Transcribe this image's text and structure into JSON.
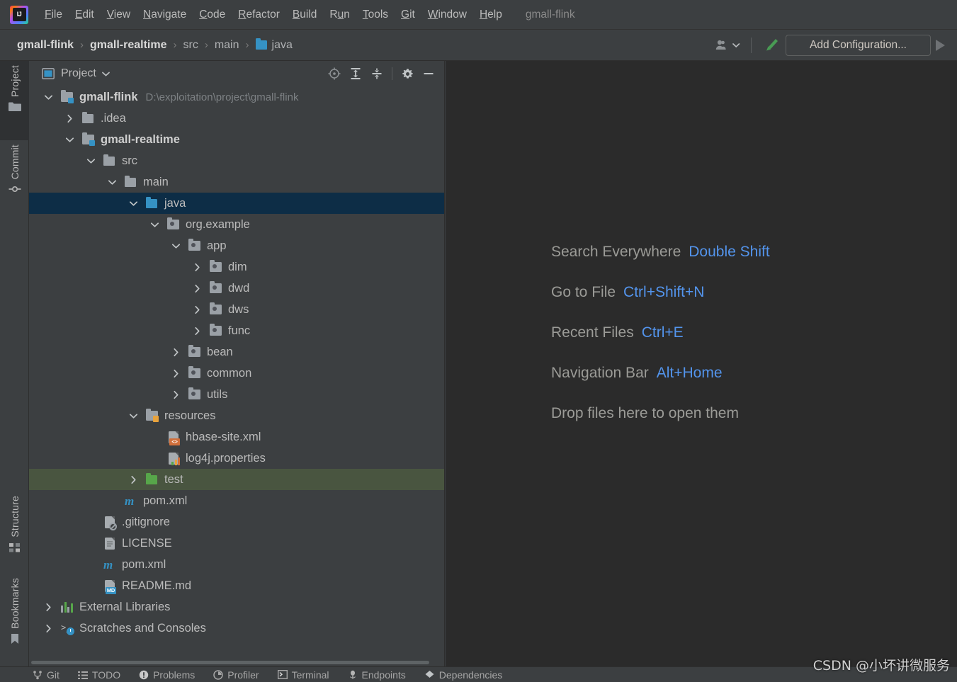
{
  "app": {
    "window_title": "gmall-flink",
    "logo_text": "IJ"
  },
  "menubar": {
    "items": [
      {
        "label": "File",
        "mnemonic": "F"
      },
      {
        "label": "Edit",
        "mnemonic": "E"
      },
      {
        "label": "View",
        "mnemonic": "V"
      },
      {
        "label": "Navigate",
        "mnemonic": "N"
      },
      {
        "label": "Code",
        "mnemonic": "C"
      },
      {
        "label": "Refactor",
        "mnemonic": "R"
      },
      {
        "label": "Build",
        "mnemonic": "B"
      },
      {
        "label": "Run",
        "mnemonic": "u"
      },
      {
        "label": "Tools",
        "mnemonic": "T"
      },
      {
        "label": "Git",
        "mnemonic": "G"
      },
      {
        "label": "Window",
        "mnemonic": "W"
      },
      {
        "label": "Help",
        "mnemonic": "H"
      }
    ]
  },
  "navbar": {
    "breadcrumbs": [
      {
        "label": "gmall-flink",
        "bold": true,
        "icon": null
      },
      {
        "label": "gmall-realtime",
        "bold": true,
        "icon": null
      },
      {
        "label": "src",
        "bold": false,
        "icon": null
      },
      {
        "label": "main",
        "bold": false,
        "icon": null
      },
      {
        "label": "java",
        "bold": false,
        "icon": "folder-blue-icon"
      }
    ],
    "separator": "›",
    "add_configuration_label": "Add Configuration...",
    "icons": [
      "user-account-icon",
      "chevron-down-icon",
      "build-hammer-icon",
      "run-play-icon"
    ]
  },
  "stripe": {
    "items": [
      {
        "label": "Project",
        "icon": "folder-icon",
        "active": true
      },
      {
        "label": "Commit",
        "icon": "commit-icon",
        "active": false
      },
      {
        "label": "Structure",
        "icon": "structure-icon",
        "active": false
      },
      {
        "label": "Bookmarks",
        "icon": "bookmark-icon",
        "active": false
      }
    ]
  },
  "project_panel": {
    "title": "Project",
    "title_icon": "project-view-icon",
    "dropdown_icon": "chevron-down-icon",
    "header_buttons": [
      {
        "name": "select-opened-file-icon"
      },
      {
        "name": "expand-all-icon"
      },
      {
        "name": "collapse-all-icon"
      },
      {
        "name": "settings-gear-icon"
      },
      {
        "name": "hide-minimize-icon"
      }
    ],
    "tree": [
      {
        "label": "gmall-flink",
        "path": "D:\\exploitation\\project\\gmall-flink",
        "indent": 0,
        "twisty": "down",
        "icon": "module-icon",
        "bold": true,
        "state": "none"
      },
      {
        "label": ".idea",
        "path": "",
        "indent": 1,
        "twisty": "right",
        "icon": "folder-grey-icon",
        "bold": false,
        "state": "none"
      },
      {
        "label": "gmall-realtime",
        "path": "",
        "indent": 1,
        "twisty": "down",
        "icon": "module-icon",
        "bold": true,
        "state": "none"
      },
      {
        "label": "src",
        "path": "",
        "indent": 2,
        "twisty": "down",
        "icon": "folder-grey-icon",
        "bold": false,
        "state": "none"
      },
      {
        "label": "main",
        "path": "",
        "indent": 3,
        "twisty": "down",
        "icon": "folder-grey-icon",
        "bold": false,
        "state": "none"
      },
      {
        "label": "java",
        "path": "",
        "indent": 4,
        "twisty": "down",
        "icon": "folder-blue-icon",
        "bold": false,
        "state": "selected-blue"
      },
      {
        "label": "org.example",
        "path": "",
        "indent": 5,
        "twisty": "down",
        "icon": "package-icon",
        "bold": false,
        "state": "none"
      },
      {
        "label": "app",
        "path": "",
        "indent": 6,
        "twisty": "down",
        "icon": "package-icon",
        "bold": false,
        "state": "none"
      },
      {
        "label": "dim",
        "path": "",
        "indent": 7,
        "twisty": "right",
        "icon": "package-icon",
        "bold": false,
        "state": "none"
      },
      {
        "label": "dwd",
        "path": "",
        "indent": 7,
        "twisty": "right",
        "icon": "package-icon",
        "bold": false,
        "state": "none"
      },
      {
        "label": "dws",
        "path": "",
        "indent": 7,
        "twisty": "right",
        "icon": "package-icon",
        "bold": false,
        "state": "none"
      },
      {
        "label": "func",
        "path": "",
        "indent": 7,
        "twisty": "right",
        "icon": "package-icon",
        "bold": false,
        "state": "none"
      },
      {
        "label": "bean",
        "path": "",
        "indent": 6,
        "twisty": "right",
        "icon": "package-icon",
        "bold": false,
        "state": "none"
      },
      {
        "label": "common",
        "path": "",
        "indent": 6,
        "twisty": "right",
        "icon": "package-icon",
        "bold": false,
        "state": "none"
      },
      {
        "label": "utils",
        "path": "",
        "indent": 6,
        "twisty": "right",
        "icon": "package-icon",
        "bold": false,
        "state": "none"
      },
      {
        "label": "resources",
        "path": "",
        "indent": 4,
        "twisty": "down",
        "icon": "resources-folder-icon",
        "bold": false,
        "state": "none"
      },
      {
        "label": "hbase-site.xml",
        "path": "",
        "indent": 5,
        "twisty": "none",
        "icon": "xml-file-icon",
        "bold": false,
        "state": "none"
      },
      {
        "label": "log4j.properties",
        "path": "",
        "indent": 5,
        "twisty": "none",
        "icon": "properties-file-icon",
        "bold": false,
        "state": "none"
      },
      {
        "label": "test",
        "path": "",
        "indent": 4,
        "twisty": "right",
        "icon": "folder-green-icon",
        "bold": false,
        "state": "selected-green"
      },
      {
        "label": "pom.xml",
        "path": "",
        "indent": 3,
        "twisty": "none",
        "icon": "maven-file-icon",
        "bold": false,
        "state": "none"
      },
      {
        "label": ".gitignore",
        "path": "",
        "indent": 2,
        "twisty": "none",
        "icon": "gitignore-file-icon",
        "bold": false,
        "state": "none"
      },
      {
        "label": "LICENSE",
        "path": "",
        "indent": 2,
        "twisty": "none",
        "icon": "text-file-icon",
        "bold": false,
        "state": "none"
      },
      {
        "label": "pom.xml",
        "path": "",
        "indent": 2,
        "twisty": "none",
        "icon": "maven-file-icon",
        "bold": false,
        "state": "none"
      },
      {
        "label": "README.md",
        "path": "",
        "indent": 2,
        "twisty": "none",
        "icon": "markdown-file-icon",
        "bold": false,
        "state": "none"
      },
      {
        "label": "External Libraries",
        "path": "",
        "indent": 0,
        "twisty": "right",
        "icon": "libraries-icon",
        "bold": false,
        "state": "none"
      },
      {
        "label": "Scratches and Consoles",
        "path": "",
        "indent": 0,
        "twisty": "right",
        "icon": "scratches-icon",
        "bold": false,
        "state": "none"
      }
    ]
  },
  "editor": {
    "tips": [
      {
        "action": "Search Everywhere",
        "shortcut": "Double Shift"
      },
      {
        "action": "Go to File",
        "shortcut": "Ctrl+Shift+N"
      },
      {
        "action": "Recent Files",
        "shortcut": "Ctrl+E"
      },
      {
        "action": "Navigation Bar",
        "shortcut": "Alt+Home"
      },
      {
        "action": "Drop files here to open them",
        "shortcut": ""
      }
    ]
  },
  "bottombar": {
    "items": [
      {
        "label": "Git",
        "icon": "git-branch-icon"
      },
      {
        "label": "TODO",
        "icon": "todo-list-icon"
      },
      {
        "label": "Problems",
        "icon": "problems-warning-icon"
      },
      {
        "label": "Profiler",
        "icon": "profiler-icon"
      },
      {
        "label": "Terminal",
        "icon": "terminal-icon"
      },
      {
        "label": "Endpoints",
        "icon": "endpoints-icon"
      },
      {
        "label": "Dependencies",
        "icon": "dependencies-icon"
      }
    ]
  },
  "watermark": {
    "text": "CSDN @小坏讲微服务"
  },
  "colors": {
    "panel_bg": "#3c3f41",
    "editor_bg": "#2b2b2b",
    "selection_blue": "#0d2d46",
    "selection_green": "#495540",
    "accent_blue": "#3592c4",
    "shortcut_blue": "#5394ec",
    "text": "#bbbbbb",
    "muted_text": "#7d8184",
    "green_run": "#57a64a"
  }
}
